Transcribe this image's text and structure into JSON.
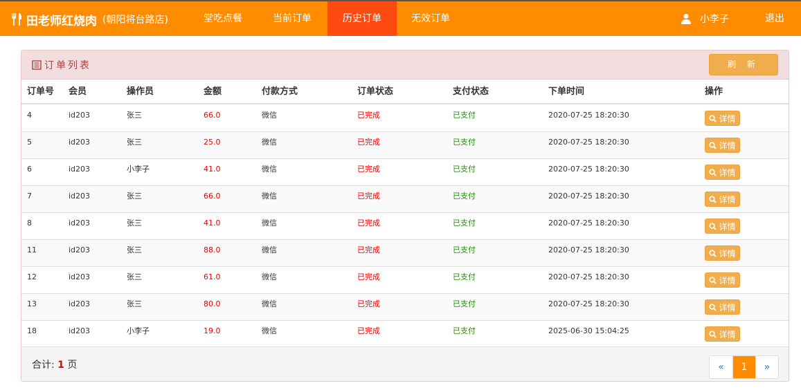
{
  "header": {
    "brand_name": "田老师红烧肉",
    "branch": "(朝阳将台路店)",
    "nav": [
      {
        "label": "堂吃点餐",
        "active": false
      },
      {
        "label": "当前订单",
        "active": false
      },
      {
        "label": "历史订单",
        "active": true
      },
      {
        "label": "无效订单",
        "active": false
      }
    ],
    "user_name": "小李子",
    "logout_label": "退出",
    "colors": {
      "bar": "#ff8c00",
      "active_tab": "#ff4a12"
    }
  },
  "panel": {
    "title": "订单列表",
    "refresh_label": "刷 新"
  },
  "table": {
    "columns": [
      "订单号",
      "会员",
      "操作员",
      "金额",
      "付款方式",
      "订单状态",
      "支付状态",
      "下单时间",
      "操作"
    ],
    "detail_label": "详情",
    "rows": [
      {
        "id": "4",
        "member": "id203",
        "operator": "张三",
        "amount": "66.0",
        "pay_method": "微信",
        "order_status": "已完成",
        "pay_status": "已支付",
        "time": "2020-07-25 18:20:30"
      },
      {
        "id": "5",
        "member": "id203",
        "operator": "张三",
        "amount": "25.0",
        "pay_method": "微信",
        "order_status": "已完成",
        "pay_status": "已支付",
        "time": "2020-07-25 18:20:30"
      },
      {
        "id": "6",
        "member": "id203",
        "operator": "小李子",
        "amount": "41.0",
        "pay_method": "微信",
        "order_status": "已完成",
        "pay_status": "已支付",
        "time": "2020-07-25 18:20:30"
      },
      {
        "id": "7",
        "member": "id203",
        "operator": "张三",
        "amount": "66.0",
        "pay_method": "微信",
        "order_status": "已完成",
        "pay_status": "已支付",
        "time": "2020-07-25 18:20:30"
      },
      {
        "id": "8",
        "member": "id203",
        "operator": "张三",
        "amount": "41.0",
        "pay_method": "微信",
        "order_status": "已完成",
        "pay_status": "已支付",
        "time": "2020-07-25 18:20:30"
      },
      {
        "id": "11",
        "member": "id203",
        "operator": "张三",
        "amount": "88.0",
        "pay_method": "微信",
        "order_status": "已完成",
        "pay_status": "已支付",
        "time": "2020-07-25 18:20:30"
      },
      {
        "id": "12",
        "member": "id203",
        "operator": "张三",
        "amount": "61.0",
        "pay_method": "微信",
        "order_status": "已完成",
        "pay_status": "已支付",
        "time": "2020-07-25 18:20:30"
      },
      {
        "id": "13",
        "member": "id203",
        "operator": "张三",
        "amount": "80.0",
        "pay_method": "微信",
        "order_status": "已完成",
        "pay_status": "已支付",
        "time": "2020-07-25 18:20:30"
      },
      {
        "id": "18",
        "member": "id203",
        "operator": "小李子",
        "amount": "19.0",
        "pay_method": "微信",
        "order_status": "已完成",
        "pay_status": "已支付",
        "time": "2025-06-30 15:04:25"
      }
    ]
  },
  "footer": {
    "total_prefix": "合计:",
    "total_pages": "1",
    "total_suffix": "页",
    "pager": {
      "prev": "«",
      "current": "1",
      "next": "»"
    }
  }
}
